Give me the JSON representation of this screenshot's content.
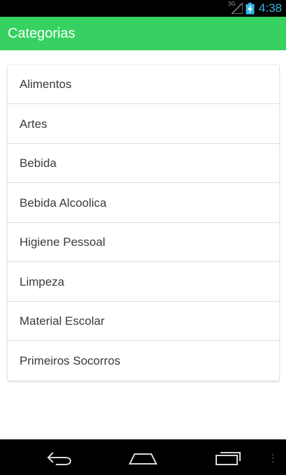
{
  "status_bar": {
    "network_type": "3G",
    "time": "4:38",
    "icons": [
      "signal-icon",
      "battery-charging-icon"
    ]
  },
  "action_bar": {
    "title": "Categorias",
    "color": "#36d160"
  },
  "categories": [
    {
      "label": "Alimentos"
    },
    {
      "label": "Artes"
    },
    {
      "label": "Bebida"
    },
    {
      "label": "Bebida Alcoolica"
    },
    {
      "label": "Higiene Pessoal"
    },
    {
      "label": "Limpeza"
    },
    {
      "label": "Material Escolar"
    },
    {
      "label": "Primeiros Socorros"
    }
  ],
  "nav_bar": {
    "icons": [
      "back-icon",
      "home-icon",
      "recents-icon"
    ]
  }
}
